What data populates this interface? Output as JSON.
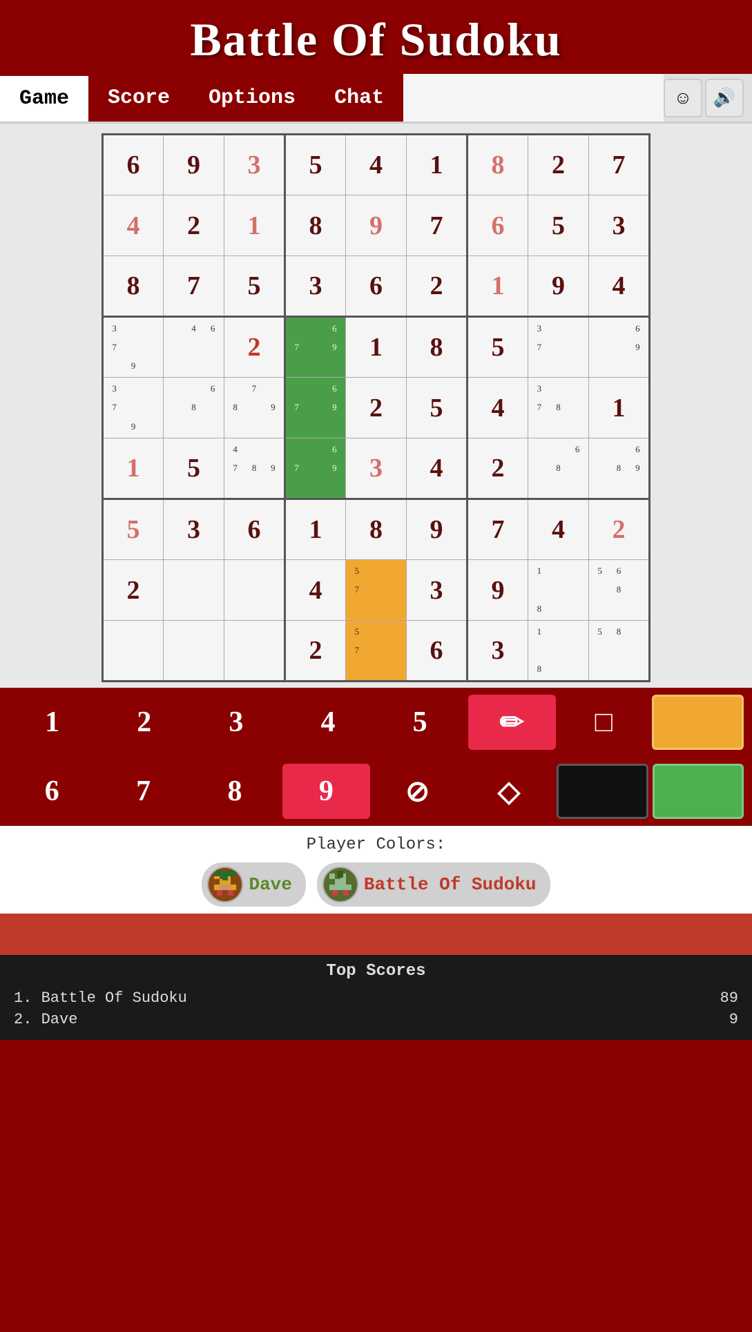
{
  "header": {
    "title": "Battle Of Sudoku"
  },
  "nav": {
    "tabs": [
      {
        "id": "game",
        "label": "Game",
        "active": true
      },
      {
        "id": "score",
        "label": "Score",
        "active": false
      },
      {
        "id": "options",
        "label": "Options",
        "active": false
      },
      {
        "id": "chat",
        "label": "Chat",
        "active": false
      }
    ],
    "emoji_icon": "☺",
    "sound_icon": "🔊"
  },
  "grid": {
    "cells": [
      [
        {
          "val": "6",
          "type": "given"
        },
        {
          "val": "9",
          "type": "given"
        },
        {
          "val": "3",
          "type": "player-light"
        },
        {
          "val": "5",
          "type": "given"
        },
        {
          "val": "4",
          "type": "given"
        },
        {
          "val": "1",
          "type": "given"
        },
        {
          "val": "8",
          "type": "player-light"
        },
        {
          "val": "2",
          "type": "given"
        },
        {
          "val": "7",
          "type": "given"
        }
      ],
      [
        {
          "val": "4",
          "type": "player-light"
        },
        {
          "val": "2",
          "type": "given"
        },
        {
          "val": "1",
          "type": "player-light"
        },
        {
          "val": "8",
          "type": "given"
        },
        {
          "val": "9",
          "type": "player-light"
        },
        {
          "val": "7",
          "type": "given"
        },
        {
          "val": "6",
          "type": "player-light"
        },
        {
          "val": "5",
          "type": "given"
        },
        {
          "val": "3",
          "type": "given"
        }
      ],
      [
        {
          "val": "8",
          "type": "given"
        },
        {
          "val": "7",
          "type": "given"
        },
        {
          "val": "5",
          "type": "given"
        },
        {
          "val": "3",
          "type": "given"
        },
        {
          "val": "6",
          "type": "given"
        },
        {
          "val": "2",
          "type": "given"
        },
        {
          "val": "1",
          "type": "player-light"
        },
        {
          "val": "9",
          "type": "given"
        },
        {
          "val": "4",
          "type": "given"
        }
      ],
      [
        {
          "val": "",
          "type": "pencil",
          "marks": [
            "3",
            "",
            "",
            "7",
            "",
            "",
            "",
            "9",
            ""
          ]
        },
        {
          "val": "",
          "type": "pencil",
          "marks": [
            "",
            "4",
            "6",
            "",
            "",
            "",
            "",
            "",
            ""
          ]
        },
        {
          "val": "2",
          "type": "player"
        },
        {
          "val": "",
          "type": "green-pencil",
          "marks": [
            "",
            "",
            "6",
            "7",
            "",
            "9",
            "",
            "",
            ""
          ]
        },
        {
          "val": "1",
          "type": "given"
        },
        {
          "val": "8",
          "type": "given"
        },
        {
          "val": "5",
          "type": "given"
        },
        {
          "val": "",
          "type": "pencil",
          "marks": [
            "3",
            "",
            "",
            "7",
            "",
            "",
            "",
            "",
            ""
          ]
        },
        {
          "val": "",
          "type": "pencil",
          "marks": [
            "",
            "",
            "6",
            "",
            "",
            "9",
            "",
            "",
            ""
          ]
        }
      ],
      [
        {
          "val": "",
          "type": "pencil",
          "marks": [
            "3",
            "",
            "",
            "7",
            "",
            "",
            "",
            "9",
            ""
          ]
        },
        {
          "val": "",
          "type": "pencil",
          "marks": [
            "",
            "",
            "6",
            "",
            "8",
            "",
            "",
            "",
            ""
          ]
        },
        {
          "val": "",
          "type": "pencil",
          "marks": [
            "",
            "7",
            "",
            "8",
            "",
            "9",
            "",
            "",
            ""
          ]
        },
        {
          "val": "",
          "type": "green-pencil",
          "marks": [
            "",
            "",
            "6",
            "7",
            "",
            "9",
            "",
            "",
            ""
          ]
        },
        {
          "val": "2",
          "type": "given"
        },
        {
          "val": "5",
          "type": "given"
        },
        {
          "val": "4",
          "type": "given"
        },
        {
          "val": "",
          "type": "pencil",
          "marks": [
            "3",
            "",
            "",
            "7",
            "8",
            "",
            "",
            "",
            ""
          ]
        },
        {
          "val": "1",
          "type": "given"
        }
      ],
      [
        {
          "val": "1",
          "type": "player-light"
        },
        {
          "val": "5",
          "type": "given"
        },
        {
          "val": "",
          "type": "pencil",
          "marks": [
            "4",
            "",
            "",
            "7",
            "8",
            "9",
            "",
            "",
            ""
          ]
        },
        {
          "val": "",
          "type": "green-pencil",
          "marks": [
            "",
            "",
            "6",
            "7",
            "",
            "9",
            "",
            "",
            ""
          ]
        },
        {
          "val": "3",
          "type": "player-light"
        },
        {
          "val": "4",
          "type": "given"
        },
        {
          "val": "2",
          "type": "given"
        },
        {
          "val": "",
          "type": "pencil",
          "marks": [
            "",
            "",
            "6",
            "",
            "8",
            "",
            "",
            "",
            ""
          ]
        },
        {
          "val": "",
          "type": "pencil",
          "marks": [
            "",
            "",
            "6",
            "",
            "8",
            "9",
            "",
            "",
            ""
          ]
        }
      ],
      [
        {
          "val": "5",
          "type": "player-light"
        },
        {
          "val": "3",
          "type": "given"
        },
        {
          "val": "6",
          "type": "given"
        },
        {
          "val": "1",
          "type": "given"
        },
        {
          "val": "8",
          "type": "given"
        },
        {
          "val": "9",
          "type": "given"
        },
        {
          "val": "7",
          "type": "given"
        },
        {
          "val": "4",
          "type": "given"
        },
        {
          "val": "2",
          "type": "player-light"
        }
      ],
      [
        {
          "val": "2",
          "type": "given"
        },
        {
          "val": "",
          "type": "empty"
        },
        {
          "val": "",
          "type": "empty"
        },
        {
          "val": "4",
          "type": "given"
        },
        {
          "val": "",
          "type": "orange-pencil",
          "marks": [
            "5",
            "",
            "",
            "7",
            "",
            "",
            "",
            "",
            ""
          ]
        },
        {
          "val": "3",
          "type": "given"
        },
        {
          "val": "9",
          "type": "given"
        },
        {
          "val": "",
          "type": "pencil",
          "marks": [
            "1",
            "",
            "",
            "",
            "",
            "",
            "8",
            "",
            ""
          ]
        },
        {
          "val": "",
          "type": "pencil",
          "marks": [
            "5",
            "6",
            "",
            "",
            "8",
            "",
            "",
            "",
            ""
          ]
        }
      ],
      [
        {
          "val": "",
          "type": "empty"
        },
        {
          "val": "",
          "type": "empty"
        },
        {
          "val": "",
          "type": "empty"
        },
        {
          "val": "2",
          "type": "given"
        },
        {
          "val": "",
          "type": "orange-pencil",
          "marks": [
            "5",
            "",
            "",
            "7",
            "",
            "",
            "",
            "",
            ""
          ]
        },
        {
          "val": "6",
          "type": "given"
        },
        {
          "val": "3",
          "type": "given"
        },
        {
          "val": "",
          "type": "pencil",
          "marks": [
            "1",
            "",
            "",
            "",
            "",
            "",
            "8",
            "",
            ""
          ]
        },
        {
          "val": "",
          "type": "pencil",
          "marks": [
            "5",
            "8",
            "",
            "",
            "",
            "",
            "",
            "",
            ""
          ]
        }
      ]
    ]
  },
  "controls": {
    "row1": [
      {
        "id": "1",
        "label": "1",
        "type": "number"
      },
      {
        "id": "2",
        "label": "2",
        "type": "number"
      },
      {
        "id": "3",
        "label": "3",
        "type": "number"
      },
      {
        "id": "4",
        "label": "4",
        "type": "number"
      },
      {
        "id": "5",
        "label": "5",
        "type": "number"
      },
      {
        "id": "pencil",
        "label": "✏",
        "type": "tool",
        "active": true
      },
      {
        "id": "square",
        "label": "□",
        "type": "tool"
      },
      {
        "id": "orange",
        "label": "",
        "type": "color",
        "color": "#F0A830"
      }
    ],
    "row2": [
      {
        "id": "6",
        "label": "6",
        "type": "number"
      },
      {
        "id": "7",
        "label": "7",
        "type": "number"
      },
      {
        "id": "8",
        "label": "8",
        "type": "number"
      },
      {
        "id": "9",
        "label": "9",
        "type": "number",
        "active": true
      },
      {
        "id": "erase",
        "label": "⊘",
        "type": "tool"
      },
      {
        "id": "fill",
        "label": "◇",
        "type": "tool"
      },
      {
        "id": "black",
        "label": "",
        "type": "color",
        "color": "#111111"
      },
      {
        "id": "green",
        "label": "",
        "type": "color",
        "color": "#4CAF50"
      }
    ]
  },
  "player_colors": {
    "label": "Player Colors:",
    "players": [
      {
        "id": "dave",
        "name": "Dave",
        "color": "#5a8a2a"
      },
      {
        "id": "bot",
        "name": "Battle Of Sudoku",
        "color": "#c0392b"
      }
    ]
  },
  "top_scores": {
    "title": "Top Scores",
    "entries": [
      {
        "rank": "1.",
        "name": "Battle Of Sudoku",
        "score": "89"
      },
      {
        "rank": "2.",
        "name": "Dave",
        "score": "9"
      }
    ]
  }
}
